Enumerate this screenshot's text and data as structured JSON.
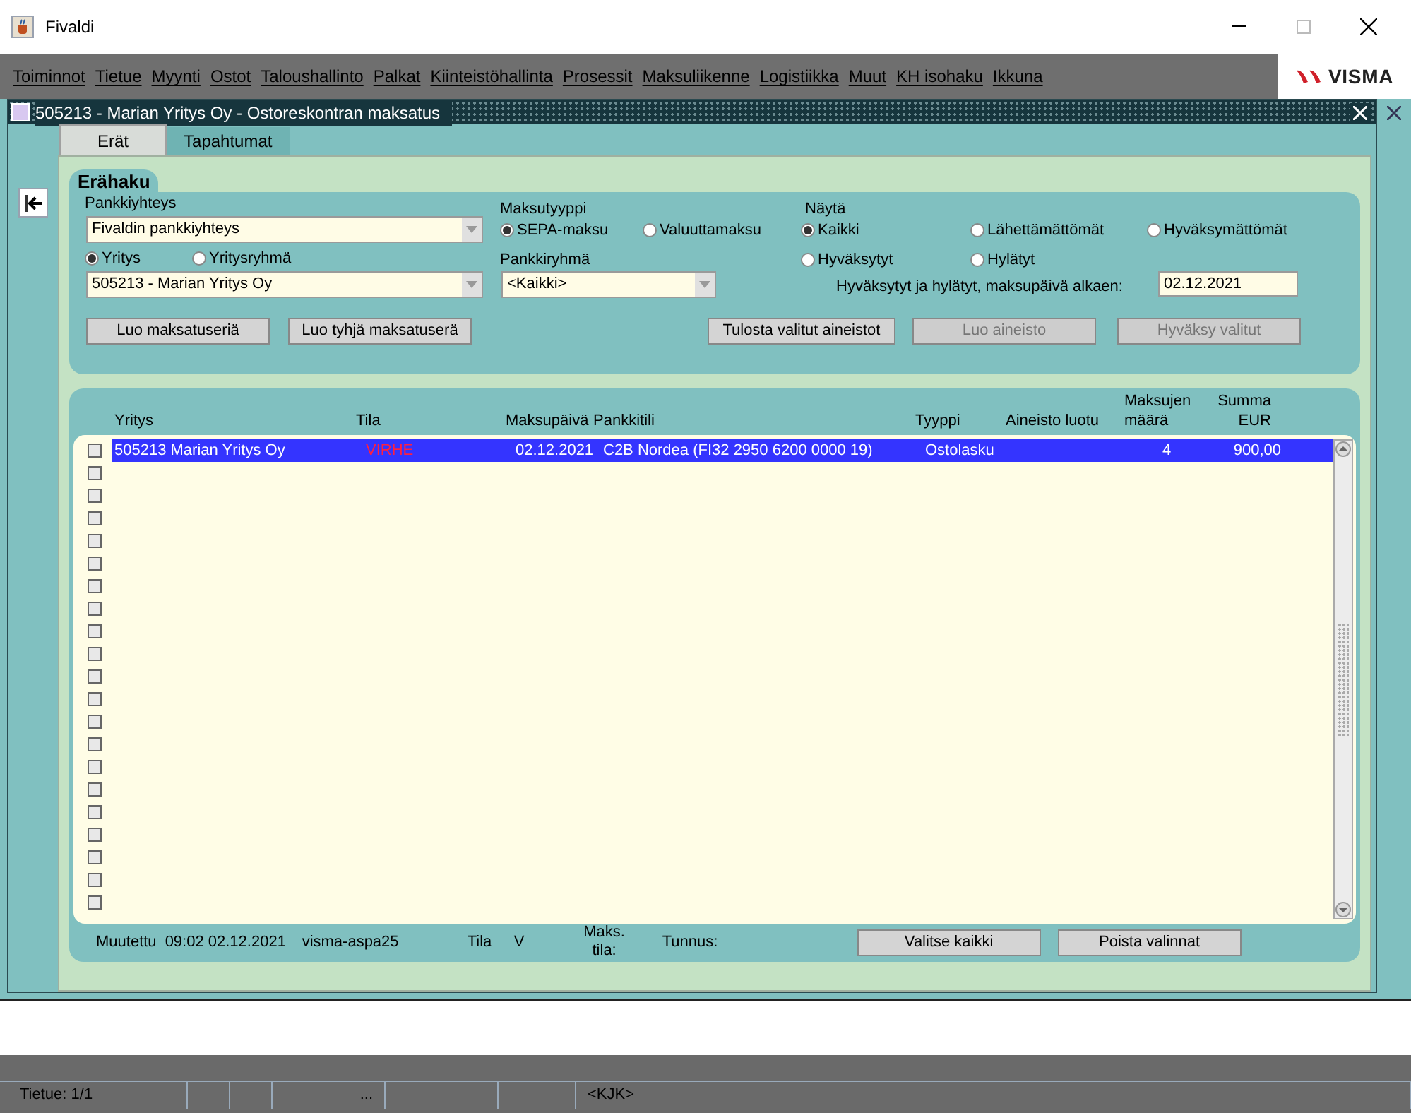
{
  "window": {
    "title": "Fivaldi"
  },
  "menu": [
    "Toiminnot",
    "Tietue",
    "Myynti",
    "Ostot",
    "Taloushallinto",
    "Palkat",
    "Kiinteistöhallinta",
    "Prosessit",
    "Maksuliikenne",
    "Logistiikka",
    "Muut",
    "KH isohaku",
    "Ikkuna"
  ],
  "logo": "VISMA",
  "form": {
    "title": "505213 - Marian Yritys Oy - Ostoreskontran maksatus",
    "tabs": [
      {
        "label": "Erät",
        "selected": true
      },
      {
        "label": "Tapahtumat",
        "selected": false
      }
    ],
    "search": {
      "title": "Erähaku",
      "bank_label": "Pankkiyhteys",
      "bank_value": "Fivaldin pankkiyhteys",
      "company_radios": [
        {
          "label": "Yritys",
          "selected": true
        },
        {
          "label": "Yritysryhmä",
          "selected": false
        }
      ],
      "company_value": "505213 - Marian Yritys Oy",
      "payment_type_label": "Maksutyyppi",
      "payment_type_radios": [
        {
          "label": "SEPA-maksu",
          "selected": true
        },
        {
          "label": "Valuuttamaksu",
          "selected": false
        }
      ],
      "bank_group_label": "Pankkiryhmä",
      "bank_group_value": "<Kaikki>",
      "show_label": "Näytä",
      "show_radios": [
        {
          "label": "Kaikki",
          "selected": true
        },
        {
          "label": "Lähettämättömät",
          "selected": false
        },
        {
          "label": "Hyväksymättömät",
          "selected": false
        },
        {
          "label": "Hyväksytyt",
          "selected": false
        },
        {
          "label": "Hylätyt",
          "selected": false
        }
      ],
      "date_label": "Hyväksytyt ja hylätyt, maksupäivä  alkaen:",
      "date_value": "02.12.2021",
      "buttons": [
        {
          "label": "Luo maksatuseriä",
          "disabled": false
        },
        {
          "label": "Luo tyhjä maksatuserä",
          "disabled": false
        },
        {
          "label": "Tulosta valitut aineistot",
          "disabled": false
        },
        {
          "label": "Luo aineisto",
          "disabled": true
        },
        {
          "label": "Hyväksy valitut",
          "disabled": true
        }
      ]
    },
    "table": {
      "columns": [
        "Yritys",
        "Tila",
        "Maksupäivä",
        "Pankkitili",
        "Tyyppi",
        "Aineisto luotu",
        "Maksujen määrä",
        "Summa EUR"
      ],
      "rows": [
        {
          "selected": true,
          "checked": false,
          "cells": [
            "505213 Marian Yritys Oy",
            "VIRHE",
            "02.12.2021",
            "C2B Nordea (FI32 2950 6200 0000 19)",
            "Ostolasku",
            "",
            "4",
            "900,00"
          ]
        },
        {
          "selected": false,
          "checked": false
        },
        {
          "selected": false,
          "checked": false
        },
        {
          "selected": false,
          "checked": false
        },
        {
          "selected": false,
          "checked": false
        },
        {
          "selected": false,
          "checked": false
        },
        {
          "selected": false,
          "checked": false
        },
        {
          "selected": false,
          "checked": false
        },
        {
          "selected": false,
          "checked": false
        },
        {
          "selected": false,
          "checked": false
        },
        {
          "selected": false,
          "checked": false
        },
        {
          "selected": false,
          "checked": false
        },
        {
          "selected": false,
          "checked": false
        },
        {
          "selected": false,
          "checked": false
        },
        {
          "selected": false,
          "checked": false
        },
        {
          "selected": false,
          "checked": false
        },
        {
          "selected": false,
          "checked": false
        },
        {
          "selected": false,
          "checked": false
        },
        {
          "selected": false,
          "checked": false
        },
        {
          "selected": false,
          "checked": false
        },
        {
          "selected": false,
          "checked": false
        }
      ]
    },
    "footer": {
      "modified_label": "Muutettu",
      "modified_value": "09:02 02.12.2021",
      "user": "visma-aspa25",
      "state_label": "Tila",
      "state_value": "V",
      "payment_state_label": "Maks. tila:",
      "id_label": "Tunnus:",
      "buttons": [
        "Valitse kaikki",
        "Poista valinnat"
      ]
    }
  },
  "status_bar": [
    "Tietue: 1/1",
    "...",
    "<KJK>"
  ]
}
